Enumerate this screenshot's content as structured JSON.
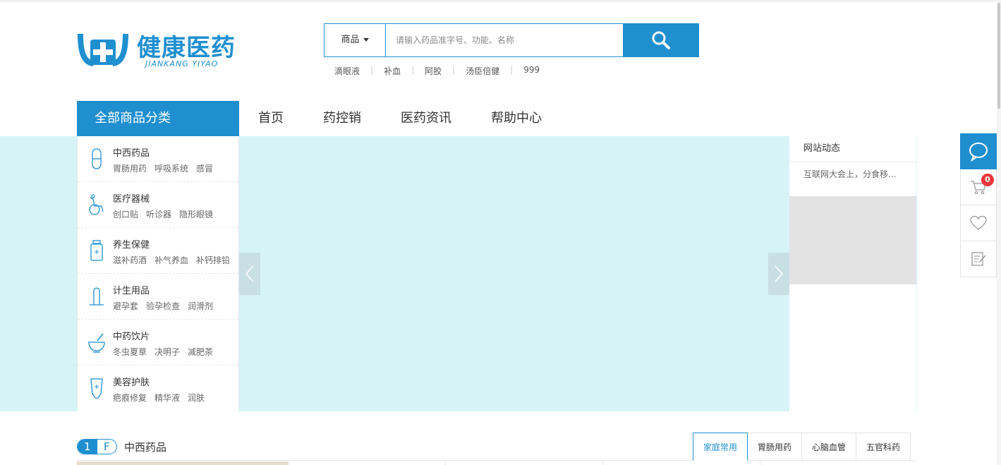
{
  "logo": {
    "cn": "健康医药",
    "en": "JIANKANG YIYAO"
  },
  "search": {
    "scope": "商品",
    "placeholder": "请输入药品准字号、功能、名称",
    "hotwords": [
      "滴眼液",
      "补血",
      "阿胶",
      "汤臣倍健",
      "999"
    ]
  },
  "nav": {
    "all_categories": "全部商品分类",
    "items": [
      "首页",
      "药控销",
      "医药资讯",
      "帮助中心"
    ]
  },
  "categories": [
    {
      "title": "中西药品",
      "subs": [
        "胃肠用药",
        "呼吸系统",
        "感冒"
      ],
      "icon": "pill-capsule-icon"
    },
    {
      "title": "医疗器械",
      "subs": [
        "创口贴",
        "听诊器",
        "隐形眼镜"
      ],
      "icon": "wheelchair-icon"
    },
    {
      "title": "养生保健",
      "subs": [
        "滋补药酒",
        "补气养血",
        "补钙排铅"
      ],
      "icon": "medicine-bottle-icon"
    },
    {
      "title": "计生用品",
      "subs": [
        "避孕套",
        "验孕检查",
        "润滑剂"
      ],
      "icon": "condom-icon"
    },
    {
      "title": "中药饮片",
      "subs": [
        "冬虫夏草",
        "决明子",
        "减肥茶"
      ],
      "icon": "mortar-bowl-icon"
    },
    {
      "title": "美容护肤",
      "subs": [
        "疤痕修复",
        "精华液",
        "润肤"
      ],
      "icon": "cream-tube-icon"
    }
  ],
  "news": {
    "heading": "网站动态",
    "items": [
      "互联网大会上，分食移..."
    ]
  },
  "sidebar": {
    "cart_count": "0"
  },
  "floor": {
    "number": "1",
    "letter": "F",
    "title": "中西药品",
    "tabs": [
      "家庭常用",
      "胃肠用药",
      "心脑血管",
      "五官科药"
    ],
    "active_tab": 0
  },
  "colors": {
    "brand": "#1f8fd0",
    "banner": "#d6f4f8",
    "badge": "#e8363a"
  }
}
